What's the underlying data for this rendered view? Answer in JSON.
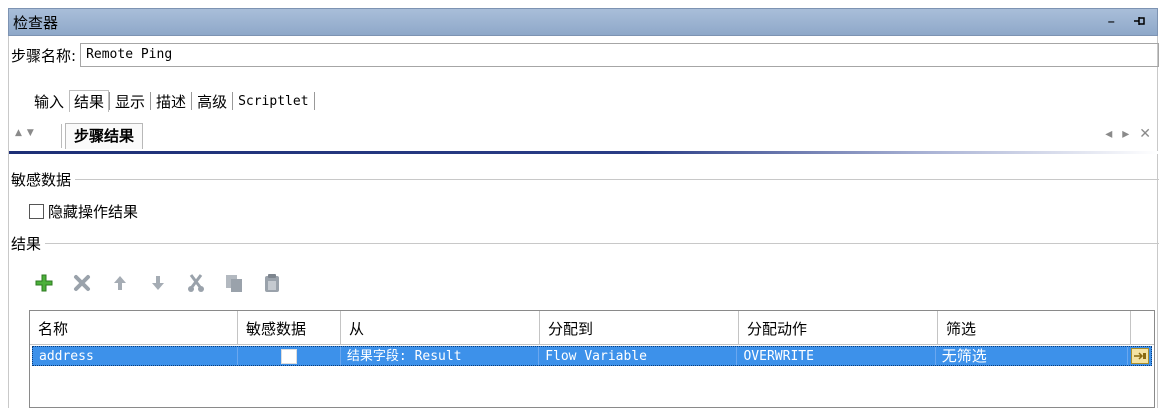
{
  "window": {
    "title": "检查器",
    "minimize_glyph": "–",
    "pin_glyph": "ᆸ"
  },
  "step": {
    "label": "步骤名称:",
    "name_value": "Remote Ping"
  },
  "tabs": [
    {
      "label": "输入"
    },
    {
      "label": "结果"
    },
    {
      "label": "显示"
    },
    {
      "label": "描述"
    },
    {
      "label": "高级"
    },
    {
      "label": "Scriptlet"
    }
  ],
  "subtabs": {
    "up_down_glyph": "▲▼",
    "active_label": "步骤结果",
    "nav_left": "◂",
    "nav_right": "▸",
    "close": "✕"
  },
  "sensitive_section": {
    "title": "敏感数据",
    "hide_checkbox_label": "隐藏操作结果",
    "hide_checked": false
  },
  "results_section": {
    "title": "结果"
  },
  "toolbar": {
    "icons": [
      "add-icon",
      "delete-icon",
      "move-up-icon",
      "move-down-icon",
      "cut-icon",
      "copy-icon",
      "paste-icon"
    ]
  },
  "results_table": {
    "columns": [
      "名称",
      "敏感数据",
      "从",
      "分配到",
      "分配动作",
      "筛选"
    ],
    "rows": [
      {
        "name": "address",
        "sensitive": false,
        "from": "结果字段: Result",
        "assign_to": "Flow Variable",
        "assign_action": "OVERWRITE",
        "filter": "无筛选"
      }
    ]
  },
  "colors": {
    "titlebar": "#8ea8c9",
    "selection": "#3d91ea",
    "accent_line": "#1d2f76",
    "add_green": "#3a9a2a"
  }
}
